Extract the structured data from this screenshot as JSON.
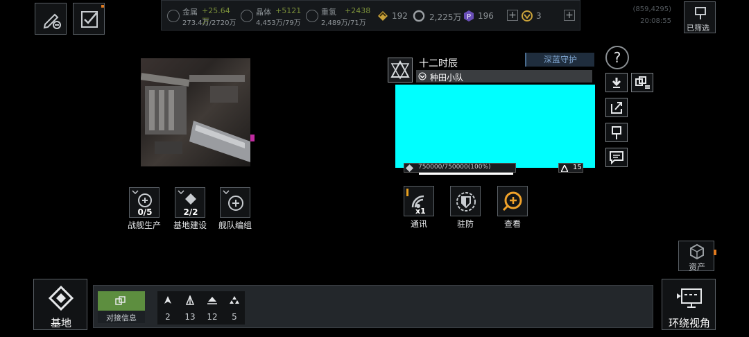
{
  "top_left": {
    "edit_icon": "pencil-minus-icon",
    "task_icon": "checklist-icon"
  },
  "resources": [
    {
      "name": "金属",
      "delta": "+25.64万",
      "value": "273.4万/2720万",
      "icon": "metal-icon"
    },
    {
      "name": "晶体",
      "delta": "+5121",
      "value": "4,453万/79万",
      "icon": "crystal-icon"
    },
    {
      "name": "重氢",
      "delta": "+2438",
      "value": "2,489万/71万",
      "icon": "deuterium-icon"
    }
  ],
  "currencies": [
    {
      "value": "192",
      "icon": "rank-icon"
    },
    {
      "value": "2,225万",
      "icon": "g-coin-icon"
    },
    {
      "value": "196",
      "icon": "p-coin-icon"
    },
    {
      "value": "3",
      "icon": "token-icon"
    }
  ],
  "coords": {
    "line1": "(859,4295)",
    "line2": "20:08:55"
  },
  "filter_label": "已筛选",
  "left_actions": [
    {
      "label": "战舰生产",
      "count": "0/5"
    },
    {
      "label": "基地建设",
      "count": "2/2"
    },
    {
      "label": "舰队编组",
      "count": ""
    }
  ],
  "target": {
    "name": "十二时辰",
    "faction_tag": "深蓝守护",
    "team": "种田小队",
    "hp_text": "750000/750000(100%)",
    "hp_fraction": 1.0,
    "level": "15",
    "panel_color": "#00ffff"
  },
  "right_actions": [
    {
      "label": "通讯",
      "badge": "x1"
    },
    {
      "label": "驻防",
      "badge": ""
    },
    {
      "label": "查看",
      "badge": ""
    }
  ],
  "side_icons": [
    "help-icon",
    "download-icon",
    "transfer-icon",
    "share-icon",
    "pin-icon",
    "message-icon"
  ],
  "assets_label": "资产",
  "base_label": "基地",
  "dock_label": "对接信息",
  "fleet": [
    {
      "count": "2",
      "icon": "ship-type-1-icon"
    },
    {
      "count": "13",
      "icon": "ship-type-2-icon"
    },
    {
      "count": "12",
      "icon": "ship-type-3-icon"
    },
    {
      "count": "5",
      "icon": "ship-type-4-icon"
    }
  ],
  "surround_label": "环绕视角"
}
